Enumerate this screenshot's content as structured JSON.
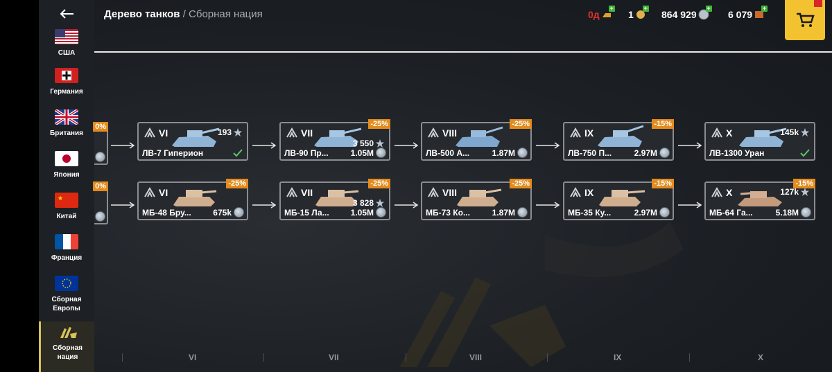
{
  "header": {
    "title": "Дерево танков",
    "separator": "/",
    "subtitle": "Сборная нация"
  },
  "currencies": {
    "premium_time": "0д",
    "boosters": "1",
    "credits": "864 929",
    "gold": "6 079"
  },
  "nations": [
    {
      "label": "США",
      "icon": "flag-usa"
    },
    {
      "label": "Германия",
      "icon": "flag-germany"
    },
    {
      "label": "Британия",
      "icon": "flag-uk"
    },
    {
      "label": "Япония",
      "icon": "flag-japan"
    },
    {
      "label": "Китай",
      "icon": "flag-china"
    },
    {
      "label": "Франция",
      "icon": "flag-france"
    },
    {
      "label": "Сборная Европы",
      "icon": "flag-europe"
    },
    {
      "label": "Сборная нация",
      "icon": "mixed-nation-emblem",
      "active": true
    }
  ],
  "partial_cards": {
    "row1": {
      "discount": "0%"
    },
    "row2": {
      "discount": "0%"
    }
  },
  "row1": [
    {
      "tier": "VI",
      "name": "ЛВ-7 Гиперион",
      "xp": "193",
      "researched": true,
      "discount": ""
    },
    {
      "tier": "VII",
      "name": "ЛВ-90 Пр...",
      "xp": "3 550",
      "price": "1.05M",
      "discount": "-25%"
    },
    {
      "tier": "VIII",
      "name": "ЛВ-500 А...",
      "price": "1.87M",
      "discount": "-25%"
    },
    {
      "tier": "IX",
      "name": "ЛВ-750 П...",
      "price": "2.97M",
      "discount": "-15%"
    },
    {
      "tier": "X",
      "name": "ЛВ-1300 Уран",
      "xp": "145k",
      "researched": true,
      "discount": ""
    }
  ],
  "row2": [
    {
      "tier": "VI",
      "name": "МБ-48 Бру...",
      "price": "675k",
      "discount": "-25%"
    },
    {
      "tier": "VII",
      "name": "МБ-15 Ла...",
      "xp": "3 828",
      "price": "1.05M",
      "discount": "-25%"
    },
    {
      "tier": "VIII",
      "name": "МБ-73 Ко...",
      "price": "1.87M",
      "discount": "-25%"
    },
    {
      "tier": "IX",
      "name": "МБ-35 Ку...",
      "price": "2.97M",
      "discount": "-15%"
    },
    {
      "tier": "X",
      "name": "МБ-64 Га...",
      "xp": "127k",
      "price": "5.18M",
      "discount": "-15%"
    }
  ],
  "tier_footer": [
    "VI",
    "VII",
    "VIII",
    "IX",
    "X"
  ],
  "colors": {
    "accent_gold": "#f2c230",
    "discount_orange": "#e48b1d",
    "check_green": "#5ec46a",
    "blue_tank": "#8fb4d6",
    "sand_tank": "#cfae8f"
  }
}
